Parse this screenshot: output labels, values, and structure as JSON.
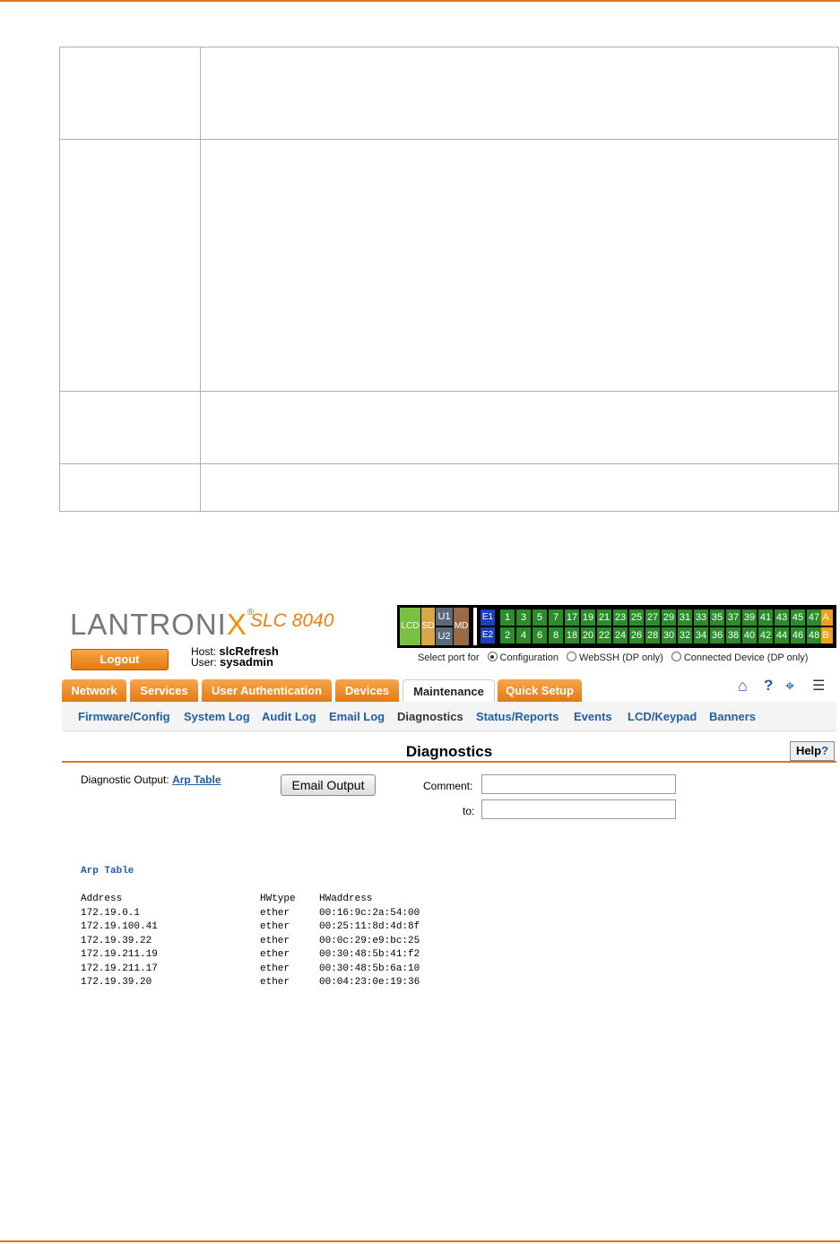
{
  "product": {
    "logo_text": "LANTRONIX",
    "model": "SLC 8040"
  },
  "session": {
    "logout_label": "Logout",
    "host_label": "Host:",
    "host_value": "slcRefresh",
    "user_label": "User:",
    "user_value": "sysadmin"
  },
  "ports": {
    "lcd": "LCD",
    "sd": "SD",
    "u1": "U1",
    "u2": "U2",
    "md": "MD",
    "e1": "E1",
    "e2": "E2",
    "top": [
      "1",
      "3",
      "5",
      "7",
      "17",
      "19",
      "21",
      "23",
      "25",
      "27",
      "29",
      "31",
      "33",
      "35",
      "37",
      "39",
      "41",
      "43",
      "45",
      "47"
    ],
    "bottom": [
      "2",
      "4",
      "6",
      "8",
      "18",
      "20",
      "22",
      "24",
      "26",
      "28",
      "30",
      "32",
      "34",
      "36",
      "38",
      "40",
      "42",
      "44",
      "46",
      "48"
    ],
    "a": "A",
    "b": "B",
    "select_label": "Select port for",
    "options": [
      "Configuration",
      "WebSSH (DP only)",
      "Connected Device (DP only)"
    ],
    "selected": "Configuration"
  },
  "tabs": [
    "Network",
    "Services",
    "User Authentication",
    "Devices",
    "Maintenance",
    "Quick Setup"
  ],
  "active_tab": "Maintenance",
  "toolbar_icons": [
    "home-icon",
    "help-icon",
    "sitemap-icon",
    "log-icon"
  ],
  "subnav": [
    "Firmware/Config",
    "System Log",
    "Audit Log",
    "Email Log",
    "Diagnostics",
    "Status/Reports",
    "Events",
    "LCD/Keypad",
    "Banners"
  ],
  "active_subnav": "Diagnostics",
  "page": {
    "title": "Diagnostics",
    "help_label": "Help",
    "diag_output_label": "Diagnostic Output:",
    "diag_output_link": "Arp Table",
    "email_button": "Email Output",
    "comment_label": "Comment:",
    "comment_value": "",
    "to_label": "to:",
    "to_value": ""
  },
  "arp": {
    "title": "Arp Table",
    "headers": [
      "Address",
      "HWtype",
      "HWaddress"
    ],
    "rows": [
      [
        "172.19.0.1",
        "ether",
        "00:16:9c:2a:54:00"
      ],
      [
        "172.19.100.41",
        "ether",
        "00:25:11:8d:4d:8f"
      ],
      [
        "172.19.39.22",
        "ether",
        "00:0c:29:e9:bc:25"
      ],
      [
        "172.19.211.19",
        "ether",
        "00:30:48:5b:41:f2"
      ],
      [
        "172.19.211.17",
        "ether",
        "00:30:48:5b:6a:10"
      ],
      [
        "172.19.39.20",
        "ether",
        "00:04:23:0e:19:36"
      ]
    ]
  }
}
